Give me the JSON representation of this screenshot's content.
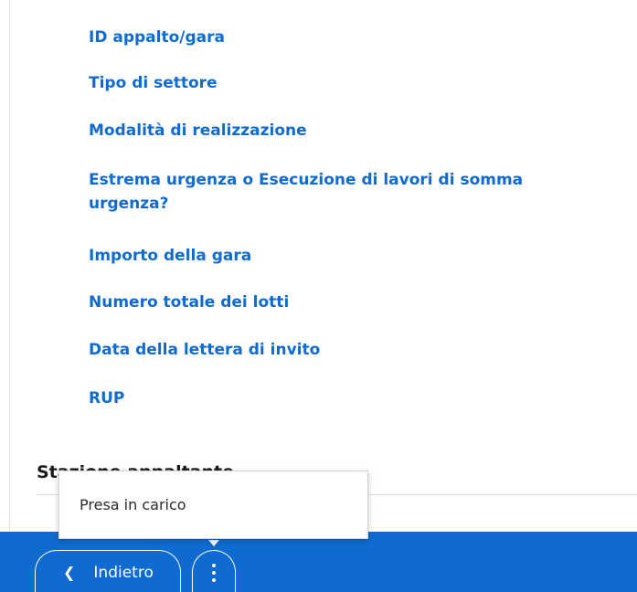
{
  "fields": {
    "items": [
      {
        "label": "ID appalto/gara"
      },
      {
        "label": "Tipo di settore"
      },
      {
        "label": "Modalità di realizzazione"
      },
      {
        "label": "Estrema urgenza o Esecuzione di lavori di somma urgenza?"
      },
      {
        "label": "Importo della gara"
      },
      {
        "label": "Numero totale dei lotti"
      },
      {
        "label": "Data della lettera di invito"
      },
      {
        "label": "RUP"
      }
    ]
  },
  "section": {
    "heading": "Stazione appaltante"
  },
  "popup_menu": {
    "items": [
      {
        "label": "Presa in carico"
      }
    ]
  },
  "footer": {
    "back_label": "Indietro",
    "back_icon": "chevron-left-icon",
    "more_icon": "more-vertical-icon"
  },
  "colors": {
    "link": "#0f6bd0",
    "footer_bar": "#0f6bd0",
    "text": "#1a1a1a",
    "background": "#ffffff"
  }
}
